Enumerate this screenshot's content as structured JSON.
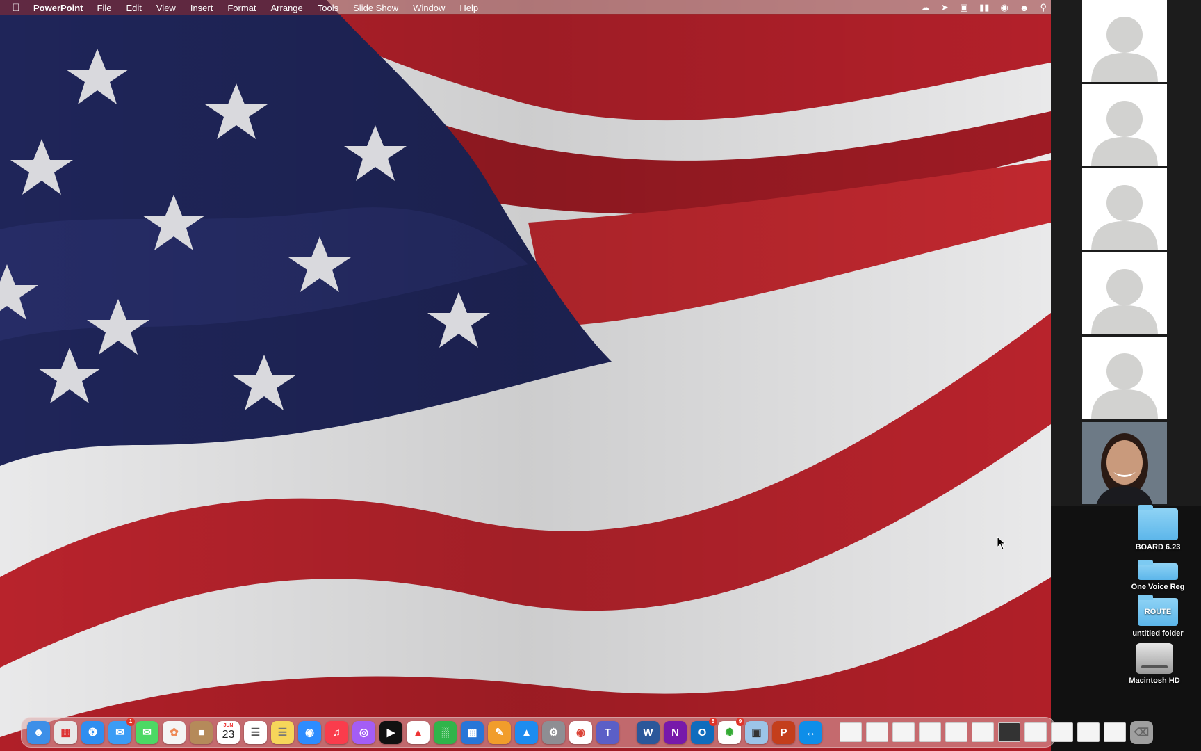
{
  "menubar": {
    "app_name": "PowerPoint",
    "menus": [
      "File",
      "Edit",
      "View",
      "Insert",
      "Format",
      "Arrange",
      "Tools",
      "Slide Show",
      "Window",
      "Help"
    ],
    "status_icons": [
      "cloud-icon",
      "location-icon",
      "display-icon",
      "battery-icon",
      "wifi-icon",
      "user-icon",
      "search-icon"
    ]
  },
  "gallery": {
    "tiles": [
      "placeholder-avatar",
      "placeholder-avatar",
      "placeholder-avatar",
      "placeholder-avatar",
      "placeholder-avatar",
      "participant-photo"
    ]
  },
  "desktop": {
    "icons": [
      {
        "label": "BOARD 6.23",
        "type": "folder"
      },
      {
        "label": "One Voice Reg",
        "type": "folder"
      },
      {
        "label": "ROUTE",
        "type": "folder"
      },
      {
        "label": "untitled folder",
        "type": "folder"
      },
      {
        "label": "Macintosh HD",
        "type": "drive"
      }
    ]
  },
  "dock": {
    "calendar_month": "JUN",
    "calendar_day": "23",
    "badges": {
      "mail": "1",
      "outlook": "5",
      "pinwheel": "9"
    },
    "colors": {
      "finder": "#3d8fe8",
      "launchpad": "#e8e8e8",
      "safari": "#2f8ef0",
      "mail": "#3b9cf5",
      "messages": "#4cd964",
      "photos": "#f4f4f4",
      "notes": "#f6d65a",
      "contacts": "#b58a5a",
      "reminders": "#ffffff",
      "zoom": "#2d8cff",
      "music": "#fa3c4c",
      "podcasts": "#a45df5",
      "tv": "#111111",
      "news": "#ffffff",
      "numbers": "#30b44a",
      "keynote": "#2876d8",
      "pages": "#f19d2b",
      "appstore": "#1d8cf0",
      "settings": "#8e8e93",
      "chrome": "#ffffff",
      "teams": "#5b5fc7",
      "word": "#2b579a",
      "onenote": "#7719aa",
      "outlook": "#0f6cbd",
      "pinwheel": "#ffffff",
      "preview": "#9cc4e8",
      "powerpoint": "#c43e1c",
      "teamviewer": "#0e8ee9"
    }
  }
}
